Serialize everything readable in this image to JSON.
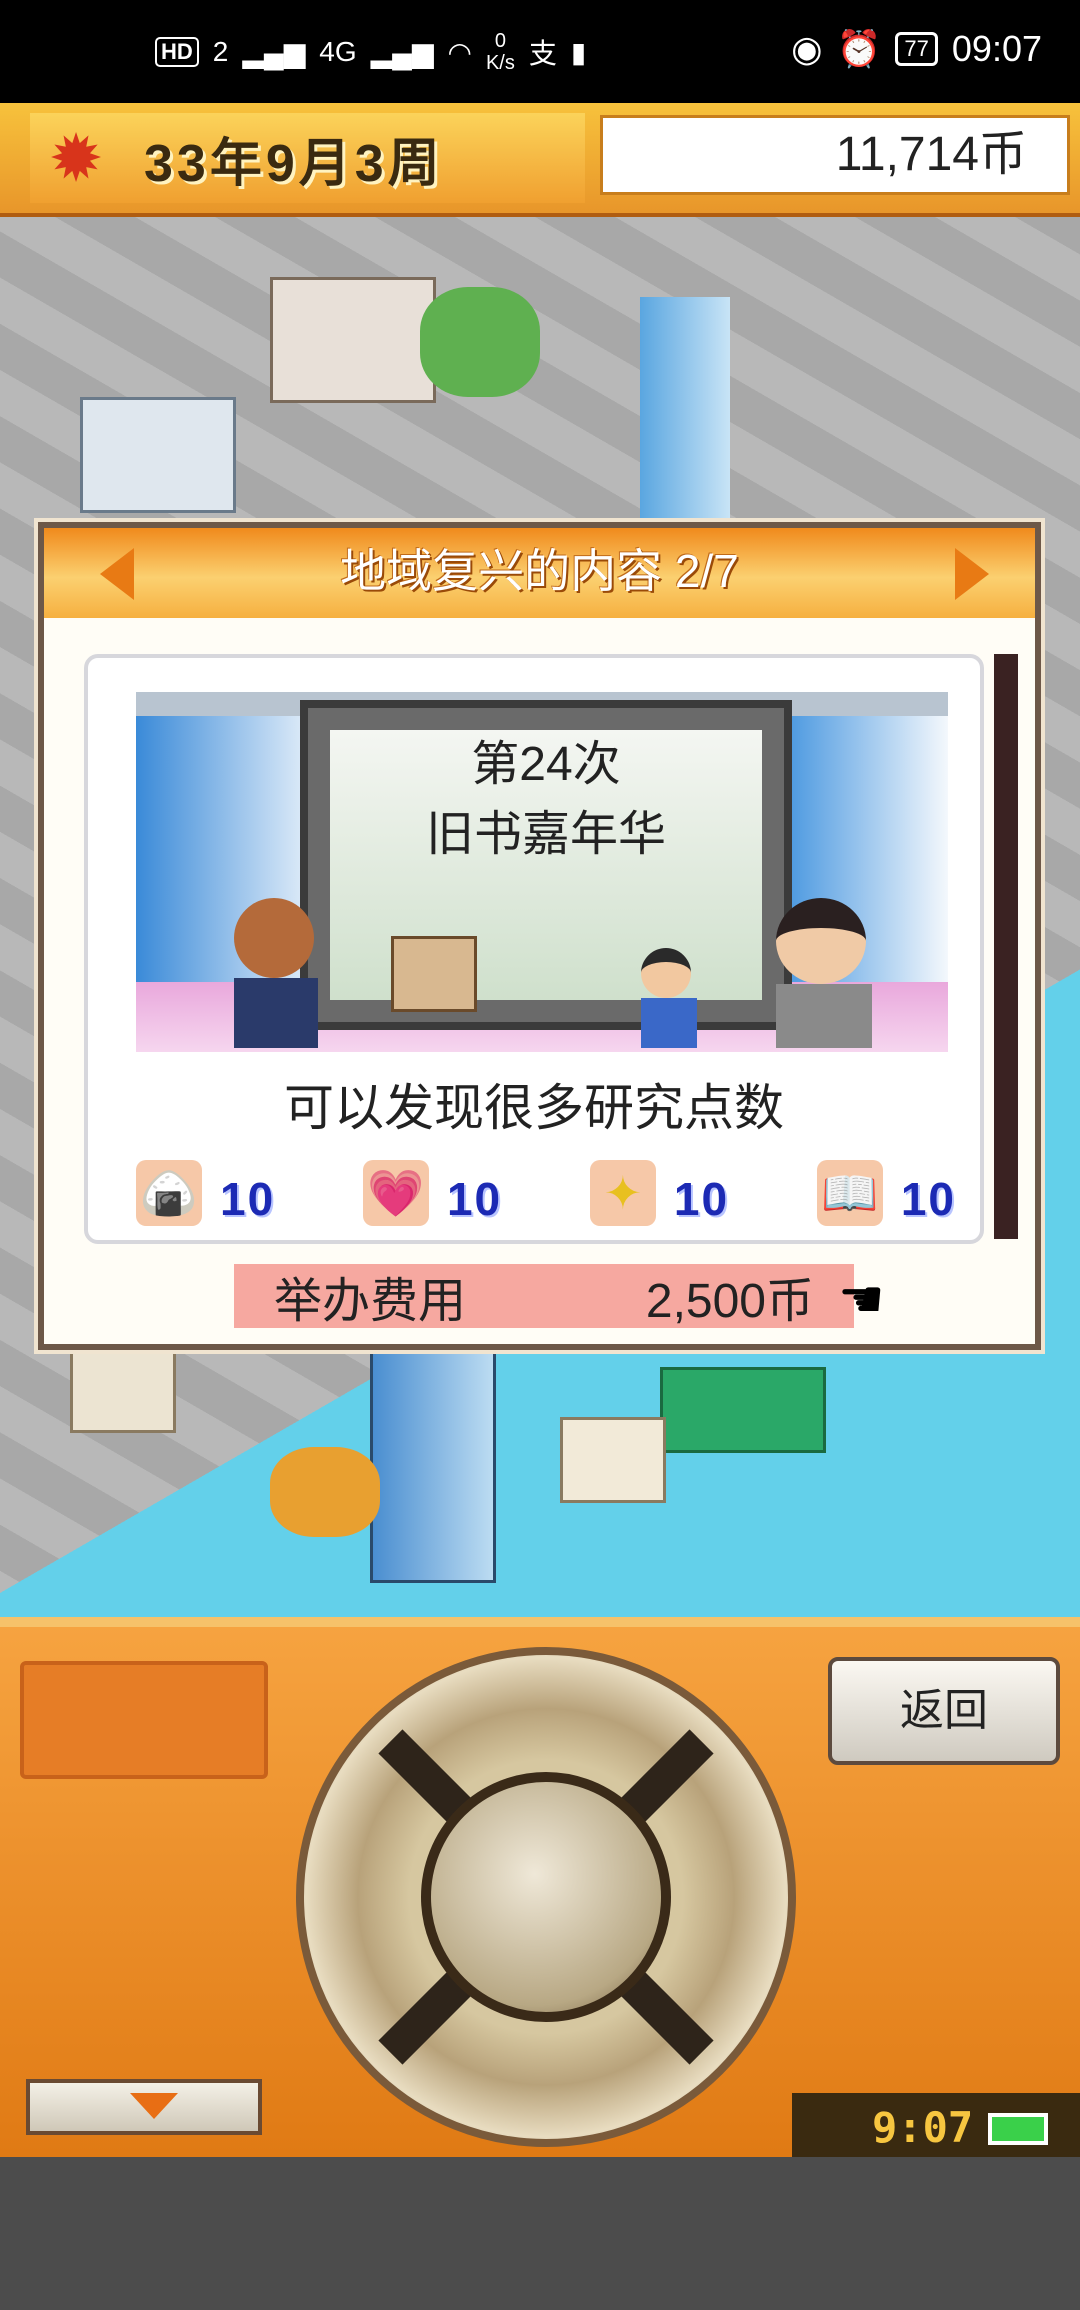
{
  "status_bar": {
    "hd_label": "HD",
    "sim_slot": "2",
    "network": "4G",
    "speed_value": "0",
    "speed_unit": "K/s",
    "battery": "77",
    "time": "09:07"
  },
  "hud": {
    "date": "33年9月3周",
    "money": "11,714币"
  },
  "dialog": {
    "title": "地域复兴的内容 2/7",
    "event_line1": "第24次",
    "event_line2": "旧书嘉年华",
    "description": "可以发现很多研究点数",
    "stats": [
      {
        "icon": "rice-ball-icon",
        "glyph": "🍙",
        "value": "10"
      },
      {
        "icon": "heart-icon",
        "glyph": "💗",
        "value": "10"
      },
      {
        "icon": "sparkle-icon",
        "glyph": "✦",
        "value": "10"
      },
      {
        "icon": "book-icon",
        "glyph": "📖",
        "value": "10"
      }
    ],
    "cost_label": "举办费用",
    "cost_value": "2,500币"
  },
  "controller": {
    "back_label": "返回",
    "clock": "9:07"
  },
  "colors": {
    "accent_orange": "#e87a14",
    "hud_yellow": "#f7c23c",
    "stat_blue": "#1c2ab4",
    "cost_pink": "#f6a8a0"
  }
}
